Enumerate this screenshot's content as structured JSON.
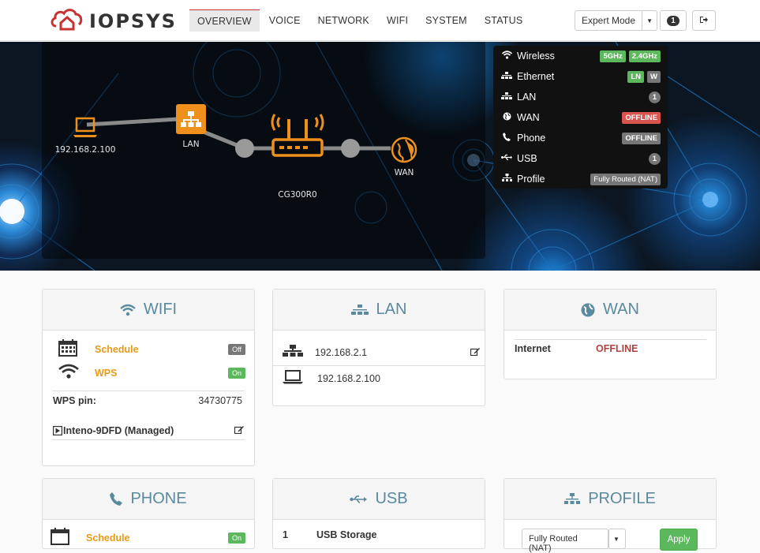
{
  "brand": {
    "name": "IOPSYS",
    "accent": "#c83032"
  },
  "nav": {
    "items": [
      {
        "label": "OVERVIEW",
        "active": true
      },
      {
        "label": "VOICE"
      },
      {
        "label": "NETWORK"
      },
      {
        "label": "WIFI"
      },
      {
        "label": "SYSTEM"
      },
      {
        "label": "STATUS"
      }
    ],
    "mode_label": "Expert Mode",
    "notification_count": "1"
  },
  "topology": {
    "client_ip": "192.168.2.100",
    "lan_label": "LAN",
    "router_label": "CG300R0",
    "wan_label": "WAN"
  },
  "status": {
    "wireless": {
      "label": "Wireless",
      "badges": [
        "5GHz",
        "2.4GHz"
      ]
    },
    "ethernet": {
      "label": "Ethernet",
      "badges": [
        "LN",
        "W"
      ]
    },
    "lan": {
      "label": "LAN",
      "count": "1"
    },
    "wan": {
      "label": "WAN",
      "state": "OFFLINE"
    },
    "phone": {
      "label": "Phone",
      "state": "OFFLINE"
    },
    "usb": {
      "label": "USB",
      "count": "1"
    },
    "profile": {
      "label": "Profile",
      "value": "Fully Routed (NAT)"
    }
  },
  "wifi_panel": {
    "title": "WIFI",
    "schedule_label": "Schedule",
    "schedule_state": "Off",
    "wps_label": "WPS",
    "wps_state": "On",
    "pin_label": "WPS pin:",
    "pin_value": "34730775",
    "network_name": "Inteno-9DFD (Managed)"
  },
  "lan_panel": {
    "title": "LAN",
    "gateway_ip": "192.168.2.1",
    "client_ip": "192.168.2.100"
  },
  "wan_panel": {
    "title": "WAN",
    "internet_label": "Internet",
    "internet_state": "OFFLINE"
  },
  "phone_panel": {
    "title": "PHONE",
    "schedule_label": "Schedule",
    "schedule_state": "On"
  },
  "usb_panel": {
    "title": "USB",
    "device_index": "1",
    "device_name": "USB Storage"
  },
  "profile_panel": {
    "title": "PROFILE",
    "selected": "Fully Routed (NAT)",
    "apply_label": "Apply"
  }
}
